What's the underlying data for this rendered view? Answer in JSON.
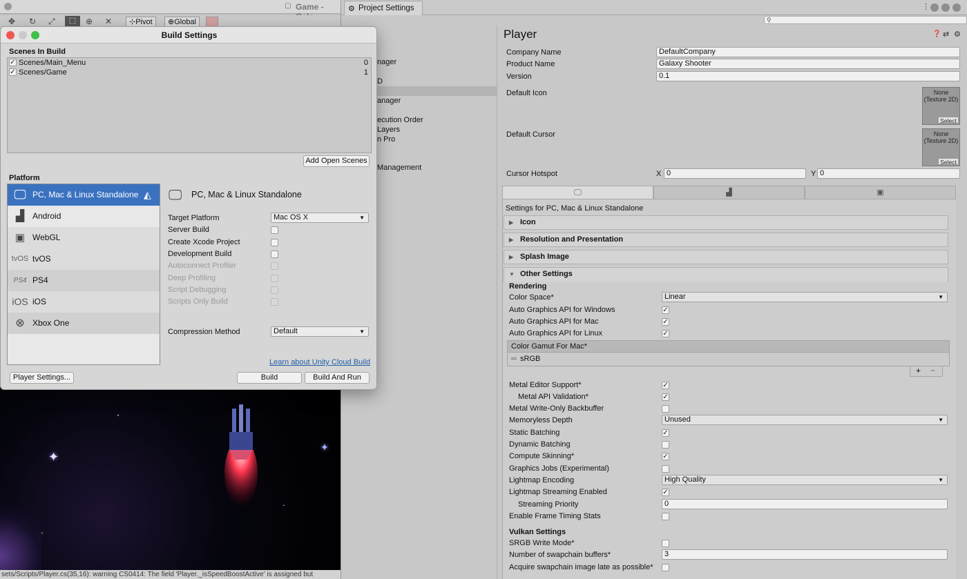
{
  "game_window": {
    "title": "Game - Gala",
    "toolbar": {
      "pivot": "Pivot",
      "global": "Global"
    },
    "console_message": "sets/Scripts/Player.cs(35,16): warning CS0414: The field 'Player._isSpeedBoostActive' is assigned but"
  },
  "project_settings": {
    "tab_title": "Project Settings",
    "categories": [
      "nager",
      "D",
      "",
      "anager",
      "ecution Order",
      "Layers",
      "n Pro",
      "",
      "Management"
    ],
    "player": {
      "header": "Player",
      "company_name_label": "Company Name",
      "company_name": "DefaultCompany",
      "product_name_label": "Product Name",
      "product_name": "Galaxy Shooter",
      "version_label": "Version",
      "version": "0.1",
      "default_icon_label": "Default Icon",
      "default_cursor_label": "Default Cursor",
      "texture_none": "None",
      "texture_type": "(Texture 2D)",
      "select": "Select",
      "cursor_hotspot_label": "Cursor Hotspot",
      "hotspot_x_label": "X",
      "hotspot_x": "0",
      "hotspot_y_label": "Y",
      "hotspot_y": "0",
      "settings_for": "Settings for PC, Mac & Linux Standalone",
      "foldouts": {
        "icon": "Icon",
        "resolution": "Resolution and Presentation",
        "splash": "Splash Image",
        "other": "Other Settings"
      },
      "rendering_header": "Rendering",
      "color_space_label": "Color Space*",
      "color_space": "Linear",
      "auto_gfx_windows": "Auto Graphics API  for Windows",
      "auto_gfx_mac": "Auto Graphics API  for Mac",
      "auto_gfx_linux": "Auto Graphics API  for Linux",
      "color_gamut_header": "Color Gamut For Mac*",
      "color_gamut_item": "sRGB",
      "plus": "+",
      "minus": "−",
      "metal_editor_support": "Metal Editor Support*",
      "metal_api_validation": "Metal API Validation*",
      "metal_write_only": "Metal Write-Only Backbuffer",
      "memoryless_depth_label": "Memoryless Depth",
      "memoryless_depth": "Unused",
      "static_batching": "Static Batching",
      "dynamic_batching": "Dynamic Batching",
      "compute_skinning": "Compute Skinning*",
      "graphics_jobs": "Graphics Jobs (Experimental)",
      "lightmap_encoding_label": "Lightmap Encoding",
      "lightmap_encoding": "High Quality",
      "lightmap_streaming": "Lightmap Streaming Enabled",
      "streaming_priority_label": "Streaming Priority",
      "streaming_priority": "0",
      "frame_timing": "Enable Frame Timing Stats",
      "vulkan_header": "Vulkan Settings",
      "srgb_write": "SRGB Write Mode*",
      "swapchain_label": "Number of swapchain buffers*",
      "swapchain": "3",
      "acquire_late": "Acquire swapchain image late as possible*"
    }
  },
  "build_settings": {
    "title": "Build Settings",
    "scenes_header": "Scenes In Build",
    "scenes": [
      {
        "name": "Scenes/Main_Menu",
        "index": "0"
      },
      {
        "name": "Scenes/Game",
        "index": "1"
      }
    ],
    "add_open_scenes": "Add Open Scenes",
    "platform_header": "Platform",
    "platforms": [
      {
        "name": "PC, Mac & Linux Standalone",
        "icon": "monitor-icon"
      },
      {
        "name": "Android",
        "icon": "android-icon"
      },
      {
        "name": "WebGL",
        "icon": "html5-icon"
      },
      {
        "name": "tvOS",
        "icon": "tvos-icon",
        "icon_text": "tvOS"
      },
      {
        "name": "PS4",
        "icon": "ps4-icon",
        "icon_text": "PS4"
      },
      {
        "name": "iOS",
        "icon": "ios-icon",
        "icon_text": "iOS"
      },
      {
        "name": "Xbox One",
        "icon": "xbox-icon"
      }
    ],
    "selected_platform_title": "PC, Mac & Linux Standalone",
    "target_platform_label": "Target Platform",
    "target_platform": "Mac OS X",
    "server_build": "Server Build",
    "create_xcode": "Create Xcode Project",
    "development_build": "Development Build",
    "autoconnect_profiler": "Autoconnect Profiler",
    "deep_profiling": "Deep Profiling",
    "script_debugging": "Script Debugging",
    "scripts_only": "Scripts Only Build",
    "compression_label": "Compression Method",
    "compression": "Default",
    "cloud_link": "Learn about Unity Cloud Build",
    "player_settings_btn": "Player Settings...",
    "build_btn": "Build",
    "build_and_run_btn": "Build And Run"
  },
  "colors": {
    "selection": "#3a72c0",
    "link": "#1f5fa8"
  }
}
